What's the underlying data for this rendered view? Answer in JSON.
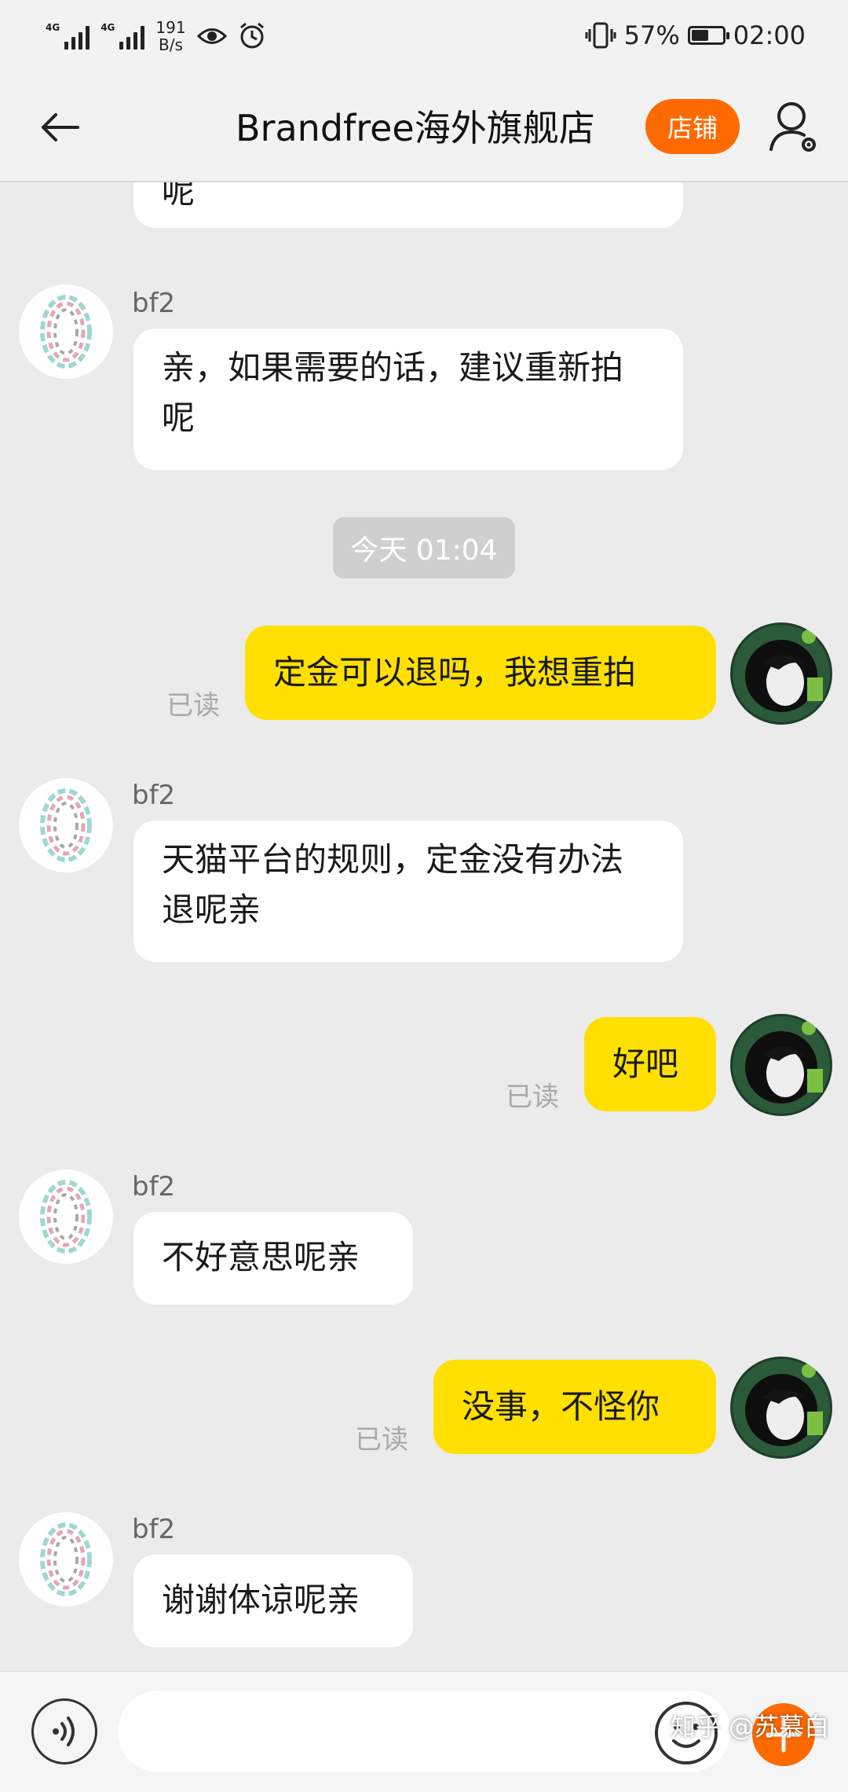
{
  "status_bar": {
    "net1": "4G",
    "net2": "4G",
    "speed_value": "191",
    "speed_unit": "B/s",
    "battery_percent": "57%",
    "battery_level": 0.57,
    "time": "02:00"
  },
  "header": {
    "title": "Brandfree海外旗舰店",
    "shop_button": "店铺",
    "accent_color": "#ff6a00"
  },
  "messages": {
    "m0": {
      "text": "呢"
    },
    "m1": {
      "sender": "bf2",
      "text": "亲，如果需要的话，建议重新拍呢"
    },
    "timestamp": "今天  01:04",
    "m2": {
      "text": "定金可以退吗，我想重拍",
      "status": "已读"
    },
    "m3": {
      "sender": "bf2",
      "text": "天猫平台的规则，定金没有办法退呢亲"
    },
    "m4": {
      "text": "好吧",
      "status": "已读"
    },
    "m5": {
      "sender": "bf2",
      "text": "不好意思呢亲"
    },
    "m6": {
      "text": "没事，不怪你",
      "status": "已读"
    },
    "m7": {
      "sender": "bf2",
      "text": "谢谢体谅呢亲"
    }
  },
  "input": {
    "value": "",
    "placeholder": ""
  },
  "watermark": "知乎 @苏慕白",
  "colors": {
    "outgoing_bubble": "#ffe000",
    "incoming_bubble": "#ffffff",
    "background": "#ebebeb"
  }
}
